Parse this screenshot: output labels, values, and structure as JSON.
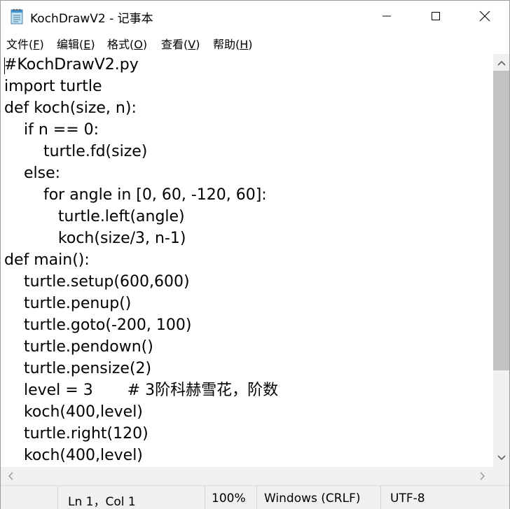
{
  "window": {
    "title": "KochDrawV2 - 记事本"
  },
  "menu": {
    "file": "文件(",
    "file_key": "F",
    "edit": "编辑(",
    "edit_key": "E",
    "format": "格式(",
    "format_key": "O",
    "view": "查看(",
    "view_key": "V",
    "help": "帮助(",
    "help_key": "H",
    "close_paren": ")"
  },
  "editor": {
    "lines": [
      "#KochDrawV2.py",
      "import turtle",
      "def koch(size, n):",
      "    if n == 0:",
      "        turtle.fd(size)",
      "    else:",
      "        for angle in [0, 60, -120, 60]:",
      "           turtle.left(angle)",
      "           koch(size/3, n-1)",
      "def main():",
      "    turtle.setup(600,600)",
      "    turtle.penup()",
      "    turtle.goto(-200, 100)",
      "    turtle.pendown()",
      "    turtle.pensize(2)",
      "    level = 3       # 3阶科赫雪花，阶数",
      "    koch(400,level)",
      "    turtle.right(120)",
      "    koch(400,level)"
    ]
  },
  "status": {
    "position": "Ln 1，Col 1",
    "zoom": "100%",
    "line_ending": "Windows (CRLF)",
    "encoding": "UTF-8"
  },
  "icons": {
    "app": "notepad-icon",
    "minimize": "minimize-icon",
    "maximize": "maximize-icon",
    "close": "close-icon"
  }
}
